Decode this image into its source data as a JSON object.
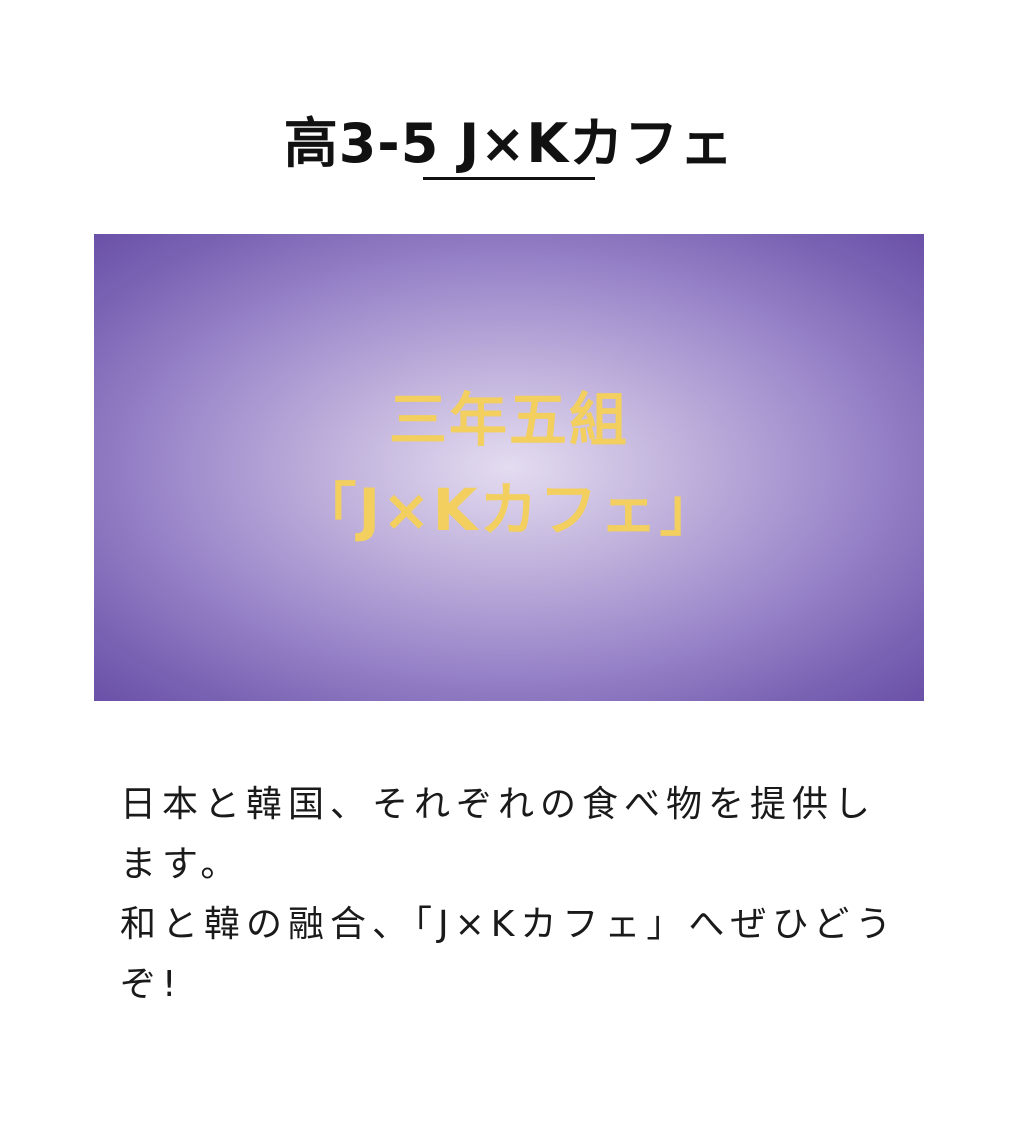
{
  "page": {
    "title": "高3-5 J×Kカフェ"
  },
  "banner": {
    "line1": "三年五組",
    "line2": "「J×Kカフェ」",
    "text_color": "#f2cf5e",
    "background_color": "#7a62b3"
  },
  "description": {
    "paragraph1": "日本と韓国、それぞれの食べ物を提供します。",
    "paragraph2": "和と韓の融合、「J×Kカフェ」へぜひどうぞ!"
  }
}
